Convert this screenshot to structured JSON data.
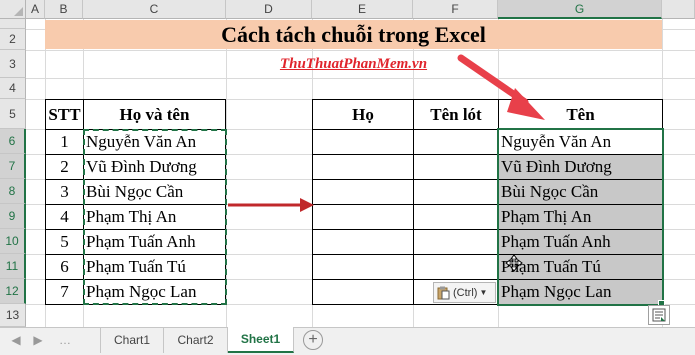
{
  "columns": [
    "A",
    "B",
    "C",
    "D",
    "E",
    "F",
    "G"
  ],
  "rows": [
    "1",
    "2",
    "3",
    "4",
    "5",
    "6",
    "7",
    "8",
    "9",
    "10",
    "11",
    "12",
    "13"
  ],
  "title": "Cách tách chuỗi trong Excel",
  "website": "ThuThuatPhanMem.vn",
  "left_table": {
    "headers": [
      "STT",
      "Họ và tên"
    ],
    "rows": [
      [
        "1",
        "Nguyễn Văn An"
      ],
      [
        "2",
        "Vũ Đình Dương"
      ],
      [
        "3",
        "Bùi Ngọc Cần"
      ],
      [
        "4",
        "Phạm Thị An"
      ],
      [
        "5",
        "Phạm Tuấn Anh"
      ],
      [
        "6",
        "Phạm Tuấn Tú"
      ],
      [
        "7",
        "Phạm Ngọc Lan"
      ]
    ]
  },
  "right_table": {
    "headers": [
      "Họ",
      "Tên lót",
      "Tên"
    ],
    "ten_values": [
      "Nguyễn Văn An",
      "Vũ Đình Dương",
      "Bùi Ngọc Cần",
      "Phạm Thị An",
      "Phạm Tuấn Anh",
      "Phạm Tuấn Tú",
      "Phạm Ngọc Lan"
    ]
  },
  "paste_options_label": "(Ctrl)",
  "sheet_tabs": [
    "Chart1",
    "Chart2",
    "Sheet1"
  ],
  "active_sheet": "Sheet1",
  "colors": {
    "title_fill": "#f8cbad",
    "website_text": "#e0242c",
    "arrow": "#c0282b",
    "selection": "#217346",
    "selected_fill": "#c8c8c8"
  },
  "icons": [
    "paste-options-icon",
    "quick-analysis-icon",
    "add-sheet-icon",
    "move-cursor-icon",
    "sheet-nav-left-icon",
    "sheet-nav-right-icon"
  ]
}
